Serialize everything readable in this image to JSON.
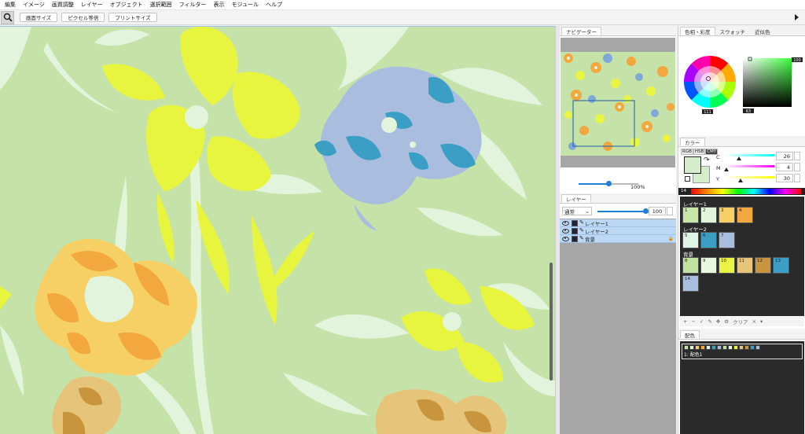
{
  "menubar": [
    "編集",
    "イメージ",
    "画質調整",
    "レイヤー",
    "オブジェクト",
    "選択範囲",
    "フィルター",
    "表示",
    "モジュール",
    "ヘルプ"
  ],
  "toolbar": {
    "btn1": "画面サイズ",
    "btn2": "ピクセル等倍",
    "btn3": "プリントサイズ"
  },
  "navigator": {
    "tab": "ナビゲーター",
    "zoom": "100%"
  },
  "layers": {
    "tab": "レイヤー",
    "blend_mode": "通常",
    "opacity": "100",
    "items": [
      "レイヤー1",
      "レイヤー2",
      "背景"
    ]
  },
  "color_tabs": [
    "色相・彩度",
    "スウォッチ",
    "近似色"
  ],
  "color_readouts": {
    "hue_label": "111",
    "sat_val": "100",
    "bri_val": "63"
  },
  "cmy": {
    "tab": "カラー",
    "modes": [
      "RGB",
      "HSB",
      "CMY"
    ],
    "channels": [
      {
        "label": "C",
        "value": "26"
      },
      {
        "label": "M",
        "value": "4"
      },
      {
        "label": "Y",
        "value": "30"
      }
    ],
    "rainbow_num": "14"
  },
  "swatches": {
    "groups": [
      {
        "name": "レイヤー1",
        "items": [
          {
            "n": "1",
            "c": "#c8e6a8"
          },
          {
            "n": "2",
            "c": "#e2f6dc"
          },
          {
            "n": "3",
            "c": "#f6d064"
          },
          {
            "n": "4",
            "c": "#f2a83e"
          }
        ]
      },
      {
        "name": "レイヤー2",
        "items": [
          {
            "n": "5",
            "c": "#dff3e7"
          },
          {
            "n": "6",
            "c": "#3a9fc2"
          },
          {
            "n": "7",
            "c": "#a9bedf"
          }
        ]
      },
      {
        "name": "背景",
        "items": [
          {
            "n": "8",
            "c": "#c2e2a2"
          },
          {
            "n": "9",
            "c": "#e8f8e0"
          },
          {
            "n": "10",
            "c": "#e9f542"
          },
          {
            "n": "11",
            "c": "#e6c57a"
          },
          {
            "n": "12",
            "c": "#c8953e"
          },
          {
            "n": "13",
            "c": "#3b9ec4"
          },
          {
            "n": "14",
            "c": "#a9bedf"
          }
        ]
      }
    ],
    "tools_label": "クリア"
  },
  "haishoku": {
    "tab": "配色",
    "entry": "1: 配色1",
    "chips": [
      "#c8e6a8",
      "#e2f6dc",
      "#f6d064",
      "#f2a83e",
      "#dff3e7",
      "#3a9fc2",
      "#a9bedf",
      "#c2e2a2",
      "#e8f8e0",
      "#e9f542",
      "#e6c57a",
      "#c8953e",
      "#3b9ec4",
      "#a9bedf"
    ]
  },
  "colors": {
    "canvas_bg": "#c5e2a8",
    "accent": "#1e7fd6",
    "layer_sel": "#bcd8f4"
  }
}
